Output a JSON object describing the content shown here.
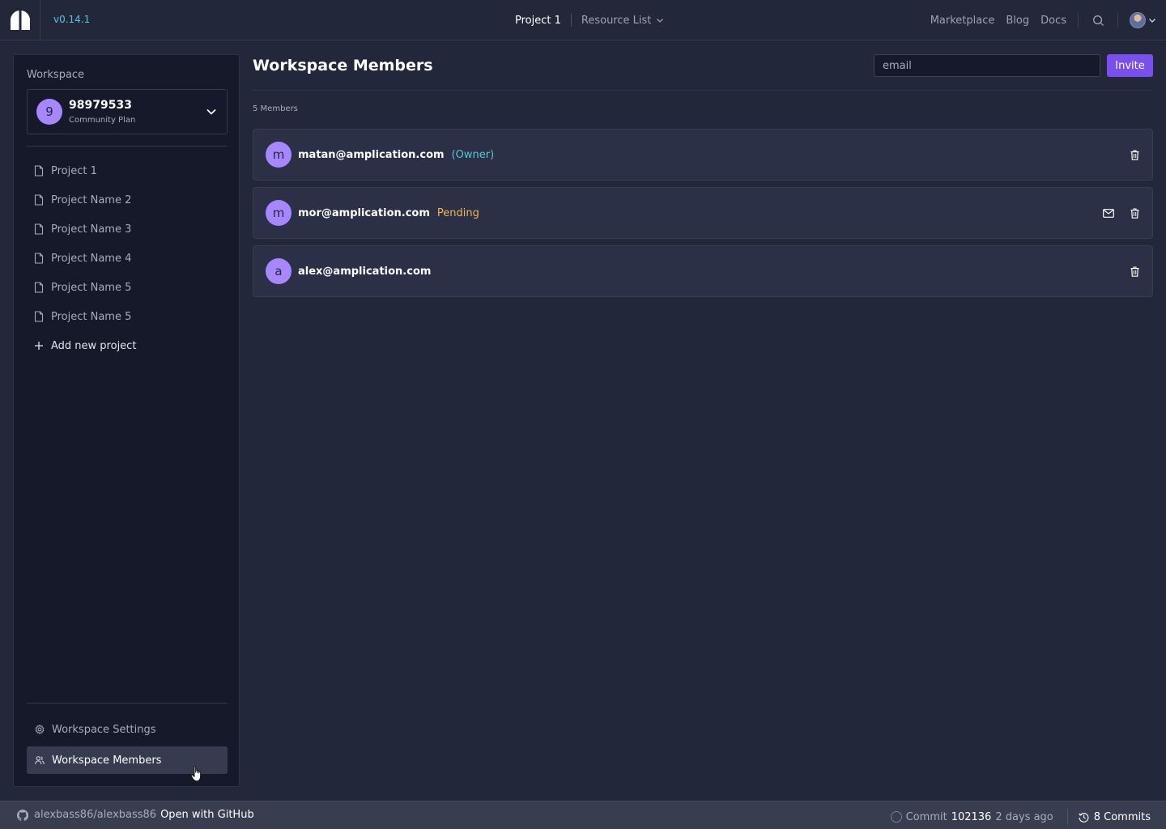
{
  "header": {
    "version": "v0.14.1",
    "project": "Project 1",
    "resource_menu": "Resource List",
    "links": {
      "marketplace": "Marketplace",
      "blog": "Blog",
      "docs": "Docs"
    },
    "icons": [
      "amplication-logo-icon",
      "chevron-down-icon",
      "search-icon",
      "user-avatar",
      "chevron-down-icon"
    ]
  },
  "sidebar": {
    "workspace_label": "Workspace",
    "workspace": {
      "initial": "9",
      "name": "98979533",
      "plan": "Community Plan"
    },
    "projects": [
      {
        "label": "Project 1"
      },
      {
        "label": "Project Name 2"
      },
      {
        "label": "Project Name 3"
      },
      {
        "label": "Project Name 4"
      },
      {
        "label": "Project Name 5"
      },
      {
        "label": "Project Name 5"
      }
    ],
    "add_project": "Add new project",
    "nav": {
      "settings": "Workspace Settings",
      "members": "Workspace Members",
      "active": "members"
    }
  },
  "main": {
    "title": "Workspace Members",
    "invite": {
      "placeholder": "email",
      "button": "Invite"
    },
    "member_count": "5 Members",
    "members": [
      {
        "initial": "m",
        "email": "matan@amplication.com",
        "tag": "(Owner)",
        "actions": [
          "delete"
        ]
      },
      {
        "initial": "m",
        "email": "mor@amplication.com",
        "tag": "Pending",
        "actions": [
          "resend-invite",
          "delete"
        ]
      },
      {
        "initial": "a",
        "email": "alex@amplication.com",
        "tag": "",
        "actions": [
          "delete"
        ]
      }
    ]
  },
  "footer": {
    "repo": "alexbass86/alexbass86",
    "github_link": "Open with GitHub",
    "commit_label": "Commit",
    "commit_id": "102136",
    "commit_time": "2 days ago",
    "commits": "8 Commits"
  },
  "colors": {
    "accent": "#7950ed",
    "avatar": "#a787ff",
    "owner": "#53c7d6",
    "pending": "#f2b359",
    "background": "#22273a",
    "sidebar": "#15192a"
  }
}
